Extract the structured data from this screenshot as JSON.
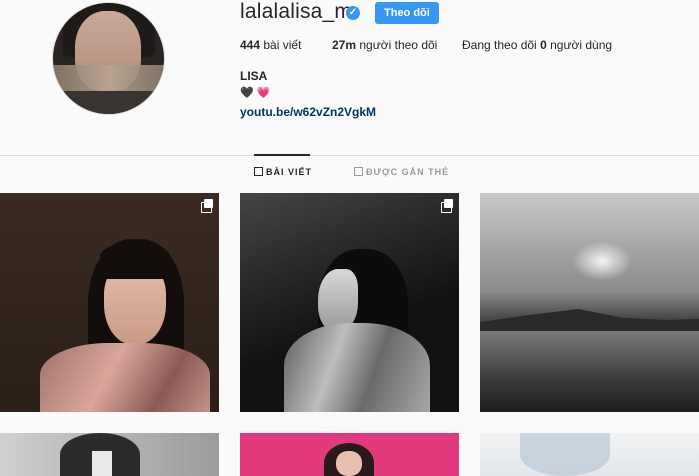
{
  "profile": {
    "username": "lalalalisa_m",
    "follow_label": "Theo dõi",
    "stats": {
      "posts_count": "444",
      "posts_label": "bài viết",
      "followers_count": "27m",
      "followers_label": "người theo dõi",
      "following_prefix": "Đang theo dõi",
      "following_count": "0",
      "following_suffix": "người dùng"
    },
    "bio_name": "LISA",
    "bio_emoji": [
      "🖤",
      "💗"
    ],
    "bio_link": "youtu.be/w62vZn2VgkM"
  },
  "tabs": [
    {
      "label": "BÀI VIẾT",
      "active": true
    },
    {
      "label": "ĐƯỢC GẮN THẺ",
      "active": false
    }
  ],
  "colors": {
    "accent": "#3897f0",
    "link": "#003569",
    "text": "#262626",
    "background": "#fafafa"
  },
  "icons": {
    "verified": "verified-badge-icon",
    "posts_tab": "grid-icon",
    "tagged_tab": "tagged-icon",
    "multi_post": "multiple-photos-icon"
  }
}
